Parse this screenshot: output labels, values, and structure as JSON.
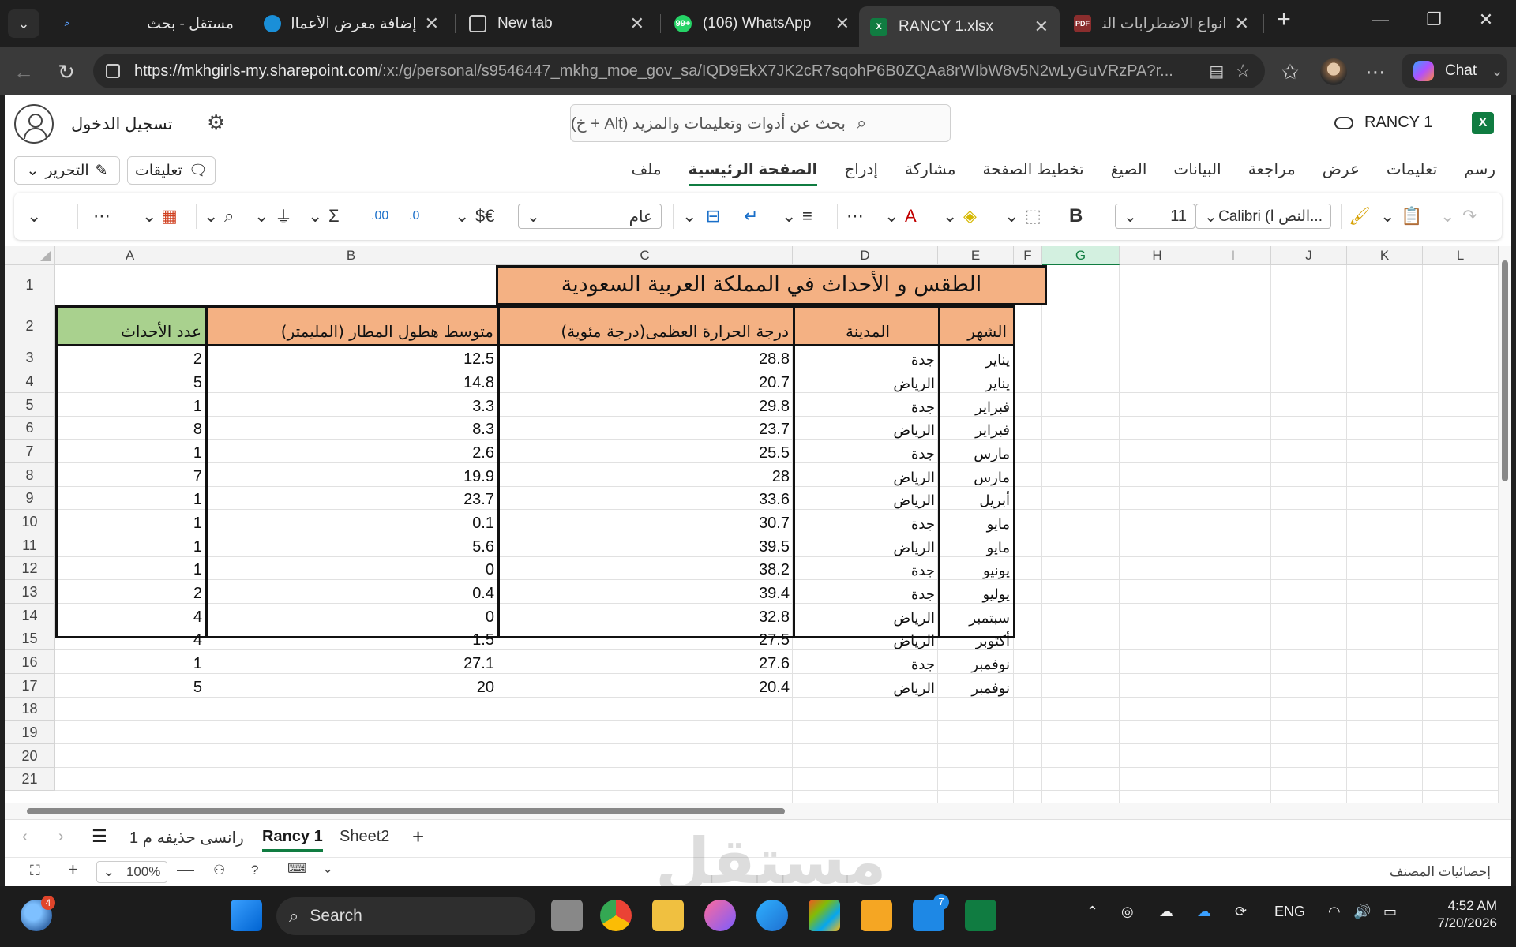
{
  "browser": {
    "tabs": [
      {
        "title": "مستقل - بحث",
        "favicon": "search-icon"
      },
      {
        "title": "إضافة معرض الأعمال",
        "favicon": "mostaql-icon"
      },
      {
        "title": "New tab",
        "favicon": "newtab-icon"
      },
      {
        "title": "(106) WhatsApp",
        "favicon": "whatsapp-icon"
      },
      {
        "title": "RANCY 1.xlsx",
        "favicon": "excel-icon"
      },
      {
        "title": "انواع الاضطرابات النفس",
        "favicon": "pdf-icon"
      }
    ],
    "url_host": "https://mkhgirls-my.sharepoint.com",
    "url_rest": "/:x:/g/personal/s9546447_mkhg_moe_gov_sa/IQD9EkX7JK2cR7sqohP6B0ZQAa8rWIbW8v5N2wLyGuVRzPA?r...",
    "chat_label": "Chat"
  },
  "excel": {
    "signin_label": "تسجيل الدخول",
    "search_placeholder": "بحث عن أدوات وتعليمات والمزيد (Alt + خ)",
    "doc_name": "RANCY 1",
    "menu": [
      "ملف",
      "الصفحة الرئيسية",
      "إدراج",
      "مشاركة",
      "تخطيط الصفحة",
      "الصيغ",
      "البيانات",
      "مراجعة",
      "عرض",
      "تعليمات",
      "رسم"
    ],
    "comments_label": "تعليقات",
    "edit_label": "التحرير",
    "ribbon": {
      "font_name": "Calibri (النص ا...",
      "font_size": "11",
      "number_format": "عام",
      "currency": "$€",
      "bold": "B"
    },
    "columns": [
      "A",
      "B",
      "C",
      "D",
      "E",
      "F",
      "G",
      "H",
      "I",
      "J",
      "K",
      "L"
    ],
    "rows": [
      "1",
      "2",
      "3",
      "4",
      "5",
      "6",
      "7",
      "8",
      "9",
      "10",
      "11",
      "12",
      "13",
      "14",
      "15",
      "16",
      "17",
      "18",
      "19",
      "20",
      "21"
    ],
    "table": {
      "title": "الطقس و الأحداث في المملكة العربية السعودية",
      "headers": {
        "month": "الشهر",
        "city": "المدينة",
        "max_temp": "درجة الحرارة العظمى(درجة مئوية)",
        "rain": "متوسط هطول المطار (المليمتر)",
        "events": "عدد الأحداث"
      },
      "data": [
        {
          "month": "يناير",
          "city": "جدة",
          "temp": "28.8",
          "rain": "12.5",
          "events": "2"
        },
        {
          "month": "يناير",
          "city": "الرياض",
          "temp": "20.7",
          "rain": "14.8",
          "events": "5"
        },
        {
          "month": "فبراير",
          "city": "جدة",
          "temp": "29.8",
          "rain": "3.3",
          "events": "1"
        },
        {
          "month": "فبراير",
          "city": "الرياض",
          "temp": "23.7",
          "rain": "8.3",
          "events": "8"
        },
        {
          "month": "مارس",
          "city": "جدة",
          "temp": "25.5",
          "rain": "2.6",
          "events": "1"
        },
        {
          "month": "مارس",
          "city": "الرياض",
          "temp": "28",
          "rain": "19.9",
          "events": "7"
        },
        {
          "month": "أبريل",
          "city": "الرياض",
          "temp": "33.6",
          "rain": "23.7",
          "events": "1"
        },
        {
          "month": "مايو",
          "city": "جدة",
          "temp": "30.7",
          "rain": "0.1",
          "events": "1"
        },
        {
          "month": "مايو",
          "city": "الرياض",
          "temp": "39.5",
          "rain": "5.6",
          "events": "1"
        },
        {
          "month": "يونيو",
          "city": "جدة",
          "temp": "38.2",
          "rain": "0",
          "events": "1"
        },
        {
          "month": "يوليو",
          "city": "جدة",
          "temp": "39.4",
          "rain": "0.4",
          "events": "2"
        },
        {
          "month": "سبتمبر",
          "city": "الرياض",
          "temp": "32.8",
          "rain": "0",
          "events": "4"
        },
        {
          "month": "أكتوبر",
          "city": "الرياض",
          "temp": "27.5",
          "rain": "1.5",
          "events": "4"
        },
        {
          "month": "نوفمبر",
          "city": "جدة",
          "temp": "27.6",
          "rain": "27.1",
          "events": "1"
        },
        {
          "month": "نوفمبر",
          "city": "الرياض",
          "temp": "20.4",
          "rain": "20",
          "events": "5"
        }
      ]
    },
    "sheets": [
      "رانسى حذيفه م 1",
      "Rancy 1",
      "Sheet2"
    ],
    "zoom": "100%",
    "status_label": "إحصائيات المصنف"
  },
  "taskbar": {
    "search_label": "Search",
    "weather_badge": "4",
    "lang": "ENG",
    "time": "4:52 AM",
    "date": "7/20/2026",
    "badge_count": "7"
  },
  "watermark": "مستقل"
}
